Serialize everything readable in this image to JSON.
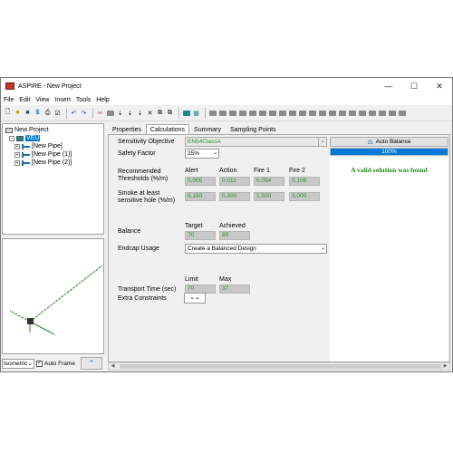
{
  "window": {
    "title": "ASPIRE - New Project",
    "controls": [
      "—",
      "☐",
      "✕"
    ]
  },
  "menu": [
    "File",
    "Edit",
    "View",
    "Insert",
    "Tools",
    "Help"
  ],
  "tree": {
    "root": "New Project",
    "veu": "VEU",
    "pipes": [
      "[New Pipe]",
      "[New Pipe (1)]",
      "[New Pipe (2)]"
    ]
  },
  "viewbar": {
    "view_mode": "Isometric",
    "auto_frame_label": "Auto Frame",
    "auto_frame_checked": true
  },
  "tabs": [
    {
      "label": "Properties",
      "active": false
    },
    {
      "label": "Calculations",
      "active": true
    },
    {
      "label": "Summary",
      "active": false
    },
    {
      "label": "Sampling Points",
      "active": false
    }
  ],
  "calc": {
    "sensitivity_objective_label": "Sensitivity Objective",
    "sensitivity_objective_value": "EN54ClassA",
    "safety_factor_label": "Safety Factor",
    "safety_factor_value": "25%",
    "cols": [
      "Alert",
      "Action",
      "Fire 1",
      "Fire 2"
    ],
    "thresholds_label_1": "Recommended",
    "thresholds_label_2": "Thresholds (%/m)",
    "thresholds": [
      "0.005",
      "0.011",
      "0.054",
      "0.108"
    ],
    "smoke_label_1": "Smoke at least",
    "smoke_label_2": "sensitive hole (%/m)",
    "smoke": [
      "0.150",
      "0.300",
      "1.500",
      "3.000"
    ],
    "balance_label": "Balance",
    "balance_target_label": "Target",
    "balance_achieved_label": "Achieved",
    "balance_target": "70",
    "balance_achieved": "85",
    "endcap_label": "Endcap Usage",
    "endcap_value": "Create a Balanced Design",
    "transport_label": "Transport Time (sec)",
    "transport_limit_label": "Limit",
    "transport_max_label": "Max",
    "transport_limit": "70",
    "transport_max": "37",
    "extra_constraints_label": "Extra Constraints",
    "extra_constraints_button": "⌄⌄"
  },
  "auto_balance": {
    "label": "Auto Balance",
    "progress_text": "100%",
    "progress": 1.0,
    "message": "A valid solution was found"
  },
  "colors": {
    "accent": "#0078d7",
    "value_green": "#2e8b2e",
    "message_green": "#1f8a1f"
  }
}
